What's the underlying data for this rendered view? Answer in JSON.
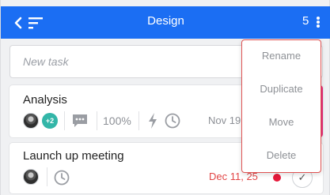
{
  "header": {
    "title": "Design",
    "count": "5",
    "background": "#1b6ef3"
  },
  "new_task": {
    "placeholder": "New task"
  },
  "tasks": [
    {
      "title": "Analysis",
      "extra_members": "+2",
      "progress": "100%",
      "date": "Nov 19",
      "priority_color": "#e62e78"
    },
    {
      "title": "Launch up meeting",
      "date": "Dec 11, 25",
      "date_color": "#e24545"
    }
  ],
  "context_menu": {
    "items": [
      "Rename",
      "Duplicate",
      "Move",
      "Delete"
    ]
  },
  "icons": [
    "chevron-left-icon",
    "sort-icon",
    "kebab-menu-icon",
    "comment-icon",
    "bolt-icon",
    "clock-icon",
    "check-icon"
  ]
}
